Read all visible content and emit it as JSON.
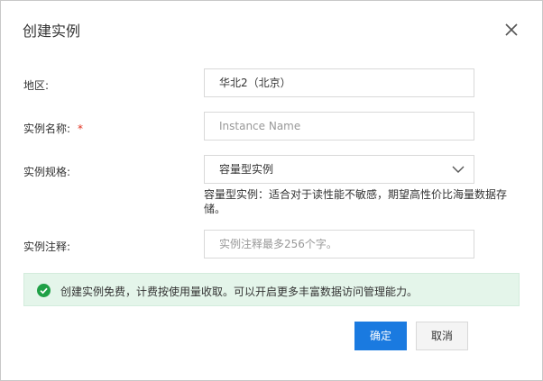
{
  "dialog": {
    "title": "创建实例",
    "close_icon": "close-icon"
  },
  "form": {
    "region": {
      "label": "地区:",
      "value": "华北2（北京）"
    },
    "name": {
      "label": "实例名称:",
      "required_mark": "*",
      "placeholder": "Instance Name"
    },
    "spec": {
      "label": "实例规格:",
      "selected": "容量型实例",
      "hint": "容量型实例：适合对于读性能不敏感，期望高性价比海量数据存储。"
    },
    "note": {
      "label": "实例注释:",
      "placeholder": "实例注释最多256个字。"
    }
  },
  "notice": {
    "icon": "check-circle-icon",
    "text": "创建实例免费，计费按使用量收取。可以开启更多丰富数据访问管理能力。",
    "color": "#e4f5ea"
  },
  "buttons": {
    "confirm": "确定",
    "cancel": "取消",
    "primary_color": "#1a7ae0"
  }
}
